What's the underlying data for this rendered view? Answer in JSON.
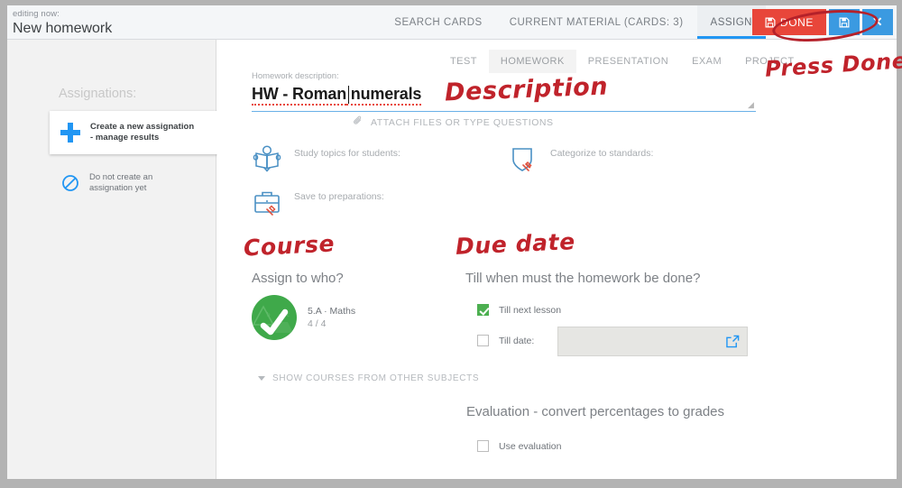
{
  "window": {
    "editing_now_label": "editing now:",
    "editing_now_value": "New homework"
  },
  "primary_tabs": [
    {
      "label": "SEARCH CARDS",
      "active": false
    },
    {
      "label": "CURRENT MATERIAL (CARDS: 3)",
      "active": false
    },
    {
      "label": "ASSIGN",
      "active": true
    }
  ],
  "titlebar_buttons": {
    "done_label": "DONE",
    "done_icon": "floppy-disk-icon",
    "done_color": "#e8463a",
    "save_icon": "floppy-disk-icon",
    "save_color": "#3b9ae1",
    "close_icon": "close-x-icon",
    "close_color": "#3b9ae1"
  },
  "sidebar": {
    "title": "Assignations:",
    "items": [
      {
        "icon": "plus-icon",
        "line1": "Create a new assignation",
        "line2": "- manage results",
        "selected": true
      },
      {
        "icon": "no-entry-icon",
        "line1": "Do not create an",
        "line2": "assignation yet",
        "selected": false
      }
    ]
  },
  "secondary_tabs": [
    {
      "label": "TEST",
      "active": false
    },
    {
      "label": "HOMEWORK",
      "active": true
    },
    {
      "label": "PRESENTATION",
      "active": false
    },
    {
      "label": "EXAM",
      "active": false
    },
    {
      "label": "PROJECT",
      "active": false
    }
  ],
  "description": {
    "label": "Homework description:",
    "value_part1": "HW - Roman",
    "value_part2": " numerals",
    "placeholder": "Homework description",
    "resize_glyph": "◢"
  },
  "attach": {
    "icon": "paperclip-icon",
    "label": "ATTACH FILES OR TYPE QUESTIONS"
  },
  "features": [
    {
      "icon": "open-book-reader-icon",
      "label": "Study topics for students:"
    },
    {
      "icon": "shield-pin-icon",
      "label": "Categorize to standards:"
    },
    {
      "icon": "briefcase-pin-icon",
      "label": "Save to preparations:"
    }
  ],
  "course": {
    "heading": "Assign to who?",
    "name": "5.A · Maths",
    "count": "4 / 4",
    "selected": true,
    "avatar_color": "#3fa94a",
    "check_icon": "check-icon",
    "show_other_label": "SHOW COURSES FROM OTHER SUBJECTS",
    "show_other_icon": "chevron-down-icon"
  },
  "due_date": {
    "heading": "Till when must the homework be done?",
    "next_lesson_label": "Till next lesson",
    "next_lesson_checked": true,
    "till_date_label": "Till date:",
    "till_date_checked": false,
    "till_date_value": "",
    "date_picker_icon": "calendar-open-icon",
    "checked_color": "#4caf50"
  },
  "evaluation": {
    "heading": "Evaluation - convert percentages to grades",
    "use_evaluation_label": "Use evaluation",
    "use_evaluation_checked": false
  },
  "annotations": {
    "color": "#c0232b",
    "description": "Description",
    "course": "Course",
    "due_date": "Due date",
    "press_done": "Press Done",
    "ellipse_target": "done-button"
  }
}
